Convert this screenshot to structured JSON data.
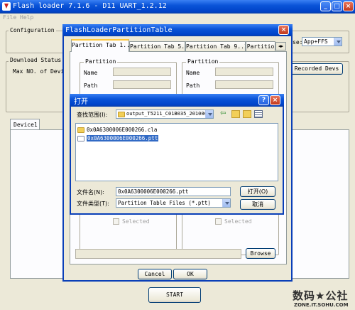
{
  "main": {
    "title": "Flash loader 7.1.6 - D11 UART_1.2.12",
    "menu": [
      "File",
      "Help"
    ],
    "configuration_label": "Configuration",
    "mode_label": "se:",
    "mode_value": "App+FFS",
    "download_status_label": "Download Status",
    "max_devices_label": "Max NO. of Device",
    "recorded_devs_button": "Recorded Devs",
    "device_tab": "Device1",
    "start_button": "START"
  },
  "partition_dialog": {
    "title": "FlashLoaderPartitionTable",
    "tabs": [
      "Partition Tab 1..4",
      "Partition Tab 5..8",
      "Partition Tab 9..12",
      "Partitio"
    ],
    "group_label": "Partition",
    "name_label": "Name",
    "path_label": "Path",
    "selected_label": "Selected",
    "browse_button": "Browse",
    "cancel_button": "Cancel",
    "ok_button": "OK"
  },
  "open_dialog": {
    "title": "打开",
    "look_in_label": "查找范围(I):",
    "look_in_value": "output_T5211_C01B035_201006:",
    "files": [
      {
        "name": "0x0A6300006E000266.cla",
        "icon": "folder-icon",
        "selected": false
      },
      {
        "name": "0x0A6300006E000266.ptt",
        "icon": "document-icon",
        "selected": true
      }
    ],
    "filename_label": "文件名(N):",
    "filename_value": "0x0A6300006E000266.ptt",
    "filetype_label": "文件类型(T):",
    "filetype_value": "Partition Table Files (*.ptt)",
    "open_button": "打开(O)",
    "cancel_button": "取消"
  },
  "watermark": {
    "brand": "数码★公社",
    "url": "ZONE.IT.SOHU.COM"
  },
  "colors": {
    "title_bar": "#0a54d8",
    "selection": "#316ac5",
    "window_bg": "#ece9d8",
    "close_button": "#c23a1c"
  }
}
